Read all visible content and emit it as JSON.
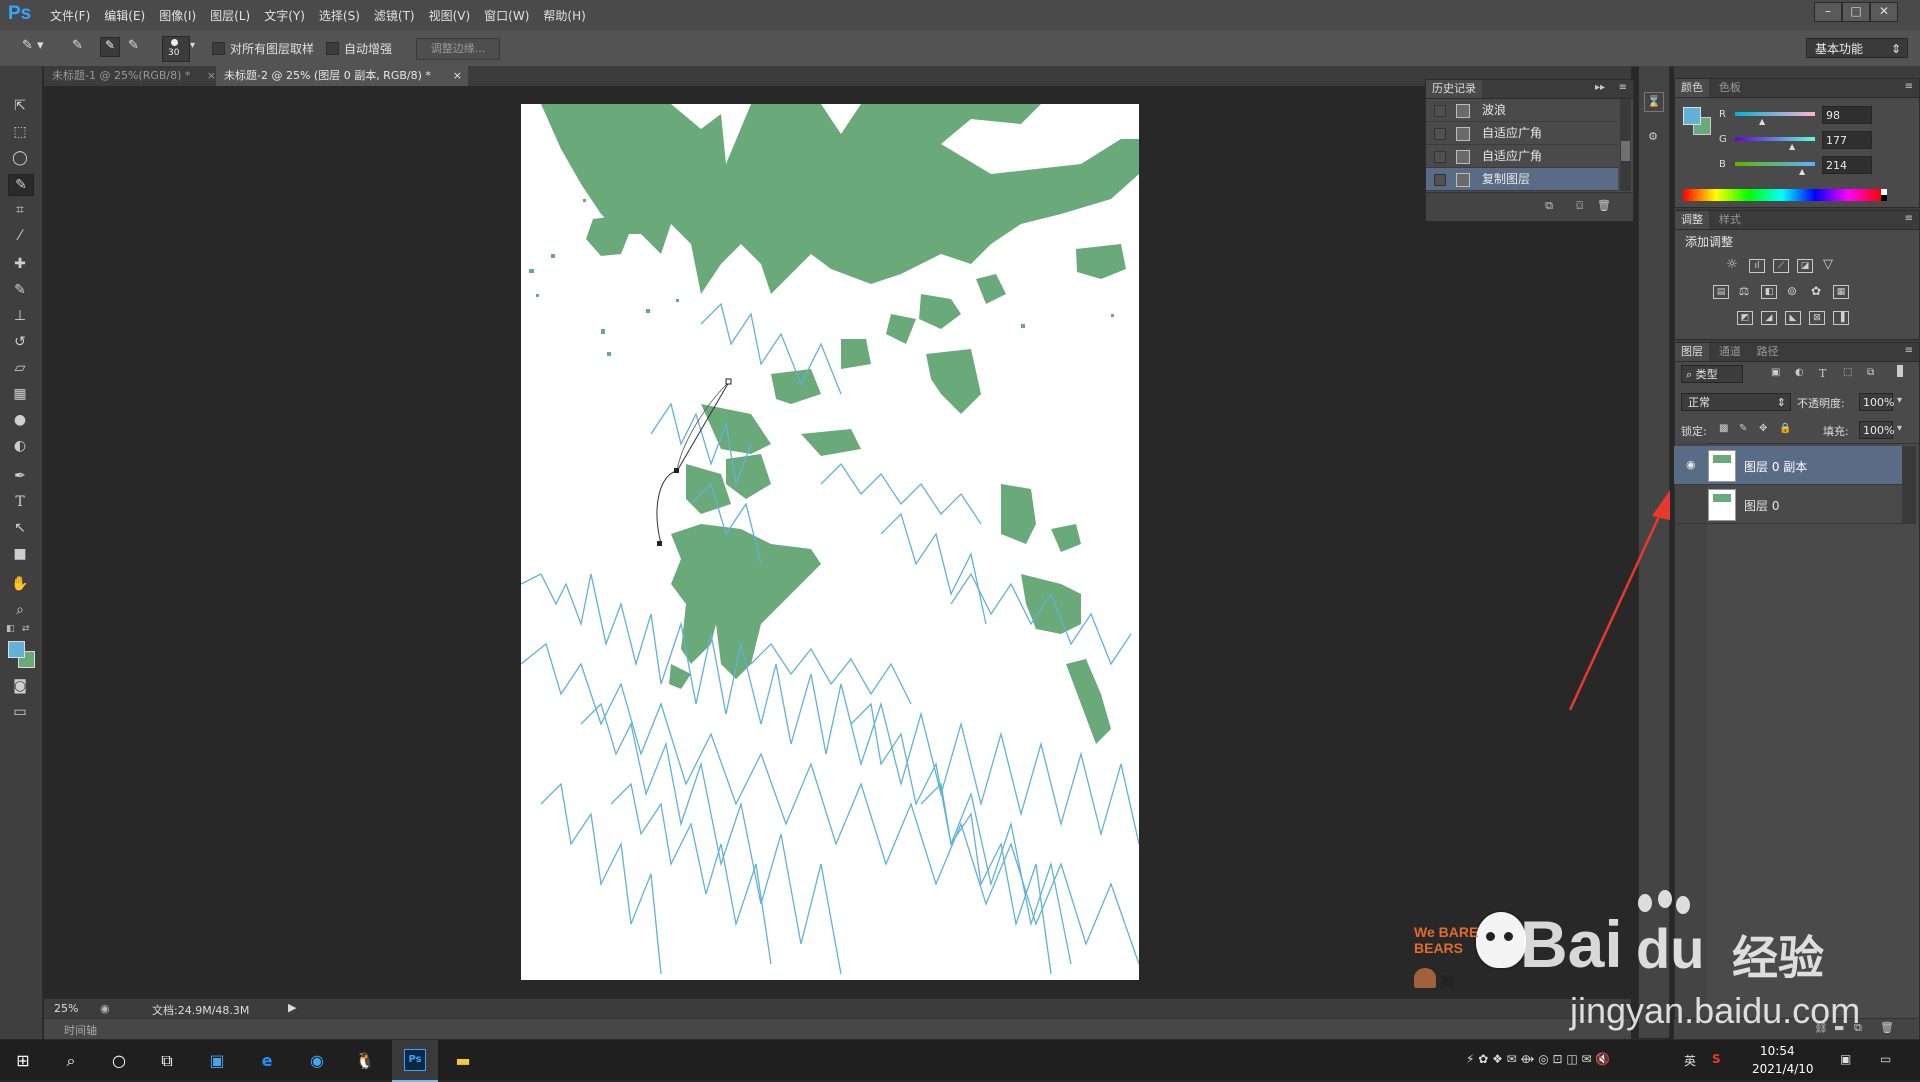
{
  "app": {
    "logo": "Ps"
  },
  "menu": [
    "文件(F)",
    "编辑(E)",
    "图像(I)",
    "图层(L)",
    "文字(Y)",
    "选择(S)",
    "滤镜(T)",
    "视图(V)",
    "窗口(W)",
    "帮助(H)"
  ],
  "window_controls": [
    "minimize-icon",
    "maximize-icon",
    "close-icon"
  ],
  "options_bar": {
    "brush_size": "30",
    "sample_all_layers_label": "对所有图层取样",
    "auto_enhance_label": "自动增强",
    "refine_edge_label": "调整边缘...",
    "workspace": "基本功能"
  },
  "doc_tabs": [
    {
      "title": "未标题-1 @ 25%(RGB/8) *",
      "active": false
    },
    {
      "title": "未标题-2 @ 25% (图层 0 副本, RGB/8) *",
      "active": true
    }
  ],
  "tools": [
    "move-tool-icon",
    "marquee-tool-icon",
    "lasso-tool-icon",
    "quick-selection-tool-icon",
    "crop-tool-icon",
    "eyedropper-tool-icon",
    "healing-brush-tool-icon",
    "brush-tool-icon",
    "clone-stamp-tool-icon",
    "history-brush-tool-icon",
    "eraser-tool-icon",
    "gradient-tool-icon",
    "blur-tool-icon",
    "dodge-tool-icon",
    "pen-tool-icon",
    "type-tool-icon",
    "path-selection-tool-icon",
    "rectangle-tool-icon",
    "hand-tool-icon",
    "zoom-tool-icon"
  ],
  "history": {
    "title": "历史记录",
    "items": [
      "波浪",
      "自适应广角",
      "自适应广角",
      "复制图层"
    ],
    "selected_index": 3
  },
  "color_panel": {
    "tabs": [
      "颜色",
      "色板"
    ],
    "r": "98",
    "g": "177",
    "b": "214",
    "r_label": "R",
    "g_label": "G",
    "b_label": "B",
    "foreground": "#62b1d6",
    "background": "#6aa97a"
  },
  "adjustments": {
    "tabs": [
      "调整",
      "样式"
    ],
    "add_label": "添加调整"
  },
  "layers": {
    "tabs": [
      "图层",
      "通道",
      "路径"
    ],
    "filter_label": "类型",
    "blend_mode": "正常",
    "opacity_label": "不透明度:",
    "opacity": "100%",
    "lock_label": "锁定:",
    "fill_label": "填充:",
    "fill": "100%",
    "items": [
      {
        "name": "图层 0 副本",
        "selected": true,
        "visible": true
      },
      {
        "name": "图层 0",
        "selected": false,
        "visible": false
      }
    ]
  },
  "status": {
    "zoom": "25%",
    "doc_info": "文档:24.9M/48.3M"
  },
  "timeline_label": "时间轴",
  "taskbar": {
    "time": "10:54",
    "date": "2021/4/10",
    "ime": "英"
  },
  "watermark": {
    "brand": "Bai",
    "brand2": "du",
    "text": "经验",
    "url": "jingyan.baidu.com",
    "sticker_text": "We BARE BEARS",
    "sticker_ime": "英"
  },
  "colors": {
    "canvas_green": "#6aa97a",
    "canvas_blue_lines": "#62b1d6",
    "ps_blue": "#31a8ff",
    "annotation_arrow": "#e8382f"
  }
}
